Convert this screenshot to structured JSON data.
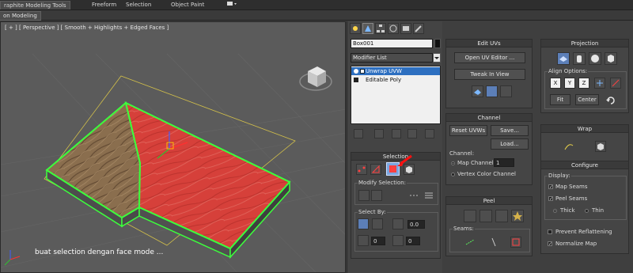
{
  "ribbon": {
    "tabs": [
      "raphite Modeling Tools",
      "Freeform",
      "Selection",
      "Object Paint"
    ],
    "subtab": "on Modeling"
  },
  "viewport": {
    "label": "[ + ] [ Perspective ] [ Smooth + Highlights + Edged Faces ]",
    "caption": "buat selection dengan face mode ..."
  },
  "command_panel": {
    "object_name": "Box001",
    "modifier_list": "Modifier List",
    "stack": [
      "Unwrap UVW",
      "Editable Poly"
    ],
    "selection": {
      "title": "Selection",
      "modify_label": "Modify Selection:",
      "select_by_label": "Select By:",
      "spinner_a": "0.0",
      "spinner_b": "0",
      "spinner_c": "0"
    }
  },
  "edit_uvs": {
    "title": "Edit UVs",
    "open_editor": "Open UV Editor ...",
    "tweak": "Tweak In View"
  },
  "channel": {
    "title": "Channel",
    "reset": "Reset UVWs",
    "save": "Save...",
    "load": "Load...",
    "channel_label": "Channel:",
    "map_channel": "Map Channel:",
    "map_channel_value": "1",
    "vertex_color": "Vertex Color Channel"
  },
  "peel": {
    "title": "Peel",
    "seams_label": "Seams:"
  },
  "projection": {
    "title": "Projection",
    "align_label": "Align Options:",
    "axes": [
      "X",
      "Y",
      "Z"
    ],
    "fit": "Fit",
    "center": "Center"
  },
  "wrap": {
    "title": "Wrap"
  },
  "configure": {
    "title": "Configure",
    "display_label": "Display:",
    "map_seams": "Map Seams",
    "peel_seams": "Peel Seams",
    "thick": "Thick",
    "thin": "Thin",
    "prevent": "Prevent Reflattening",
    "normalize": "Normalize Map"
  },
  "colors": {
    "selected_face": "#d6403a",
    "wood": "#8a6e4e",
    "selection_outline": "#3cff3c",
    "highlight_blue": "#2d6fc0"
  }
}
